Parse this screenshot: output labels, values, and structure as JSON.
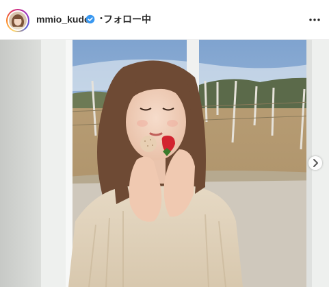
{
  "header": {
    "username": "mmio_kudo",
    "separator": "・",
    "follow_status": "フォロー中"
  },
  "icons": {
    "avatar": "profile-avatar",
    "verified": "verified-badge-icon",
    "more": "more-options-icon",
    "next": "chevron-right-icon"
  },
  "colors": {
    "verified_blue": "#3897f0",
    "text": "#262626"
  }
}
